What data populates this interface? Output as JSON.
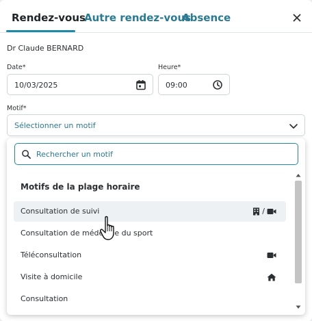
{
  "tabs": [
    {
      "label": "Rendez-vous",
      "active": true
    },
    {
      "label": "Autre rendez-vous",
      "active": false
    },
    {
      "label": "Absence",
      "active": false
    }
  ],
  "close_icon": "close-icon",
  "doctor": "Dr Claude BERNARD",
  "date": {
    "label": "Date*",
    "value": "10/03/2025",
    "icon": "calendar-icon"
  },
  "time": {
    "label": "Heure*",
    "value": "09:00",
    "icon": "clock-icon"
  },
  "reason": {
    "label": "Motif*",
    "placeholder": "Sélectionner un motif",
    "icon": "chevron-down-icon"
  },
  "dropdown": {
    "search_placeholder": "Rechercher un motif",
    "group_title": "Motifs de la plage horaire",
    "options": [
      {
        "label": "Consultation de suivi",
        "icons": [
          "building-icon",
          "video-icon"
        ],
        "separator": "/",
        "hovered": true
      },
      {
        "label": "Consultation de médecine du sport",
        "icons": []
      },
      {
        "label": "Téléconsultation",
        "icons": [
          "video-icon"
        ]
      },
      {
        "label": "Visite à domicile",
        "icons": [
          "home-icon"
        ]
      },
      {
        "label": "Consultation",
        "icons": []
      }
    ]
  },
  "colors": {
    "accent": "#1f8aa6",
    "link_text": "#2a7a92",
    "text": "#2b2f33"
  }
}
